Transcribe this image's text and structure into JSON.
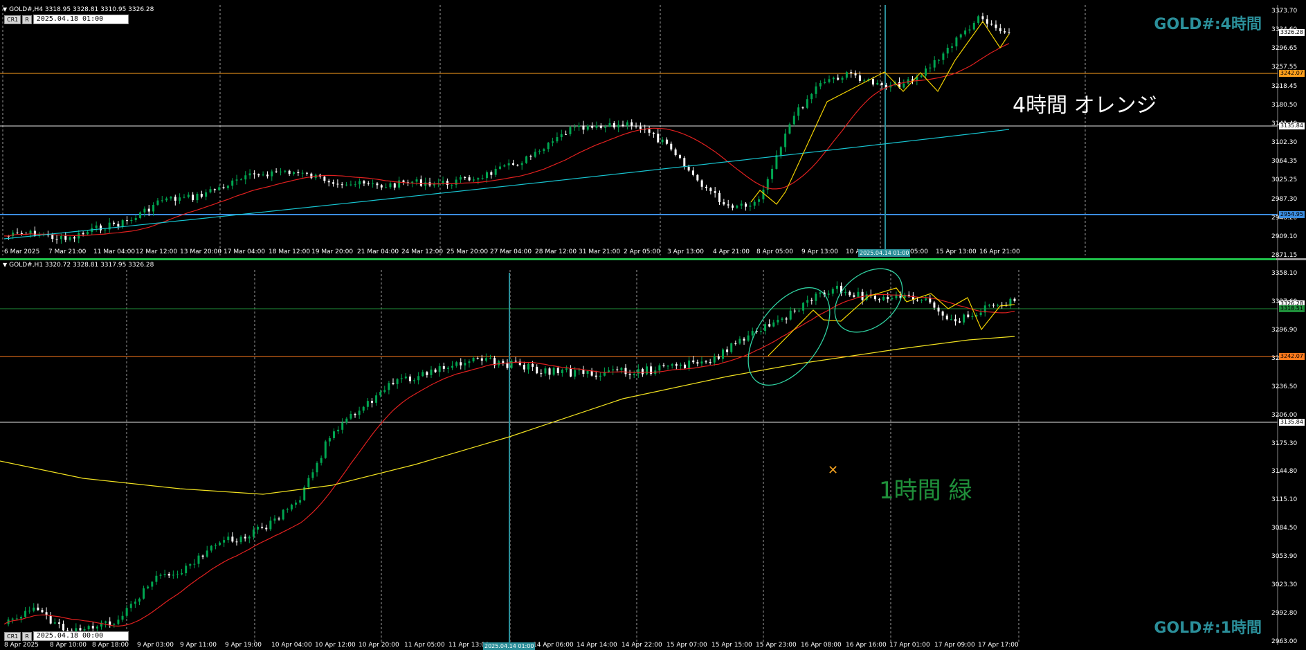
{
  "top": {
    "header": "GOLD#,H4  3318.95 3328.81 3310.95 3326.28",
    "cr_label": "CR1",
    "r_label": "R",
    "date_value": "2025.04.18 01:00",
    "watermark": "GOLD#:4時間",
    "note": "4時間  オレンジ",
    "price_labels": [
      "3373.70",
      "3334.60",
      "3296.65",
      "3257.55",
      "3218.45",
      "3180.50",
      "3141.40",
      "3102.30",
      "3064.35",
      "3025.25",
      "2987.30",
      "2948.20",
      "2909.10",
      "2871.15"
    ],
    "tags": {
      "current": "3326.28",
      "orange": "3242.07",
      "white": "3135.84",
      "blue": "2954.95"
    },
    "time_labels": [
      "6 Mar 2025",
      "7 Mar 21:00",
      "11 Mar 04:00",
      "12 Mar 12:00",
      "13 Mar 20:00",
      "17 Mar 04:00",
      "18 Mar 12:00",
      "19 Mar 20:00",
      "21 Mar 04:00",
      "24 Mar 12:00",
      "25 Mar 20:00",
      "27 Mar 04:00",
      "28 Mar 12:00",
      "31 Mar 21:00",
      "2 Apr 05:00",
      "3 Apr 13:00",
      "4 Apr 21:00",
      "8 Apr 05:00",
      "9 Apr 13:00",
      "10 A",
      "05:00",
      "15 Apr 13:00",
      "16 Apr 21:00"
    ],
    "time_selected": "2025.04.14 01:00",
    "colors": {
      "bull": "#00a651",
      "bear": "#ffffff",
      "ma_fast": "#e0201f",
      "ma_slow": "#17c4d0",
      "zigzag": "#f0d000",
      "orange_line": "#ff9f1c",
      "blue_line": "#3b8de0",
      "cursor": "#2b8f9a"
    }
  },
  "bottom": {
    "header": "GOLD#,H1  3320.72 3328.81 3317.95 3326.28",
    "cr_label": "CR1",
    "r_label": "R",
    "date_value": "2025.04.18 00:00",
    "watermark": "GOLD#:1時間",
    "note": "1時間  緑",
    "price_labels": [
      "3358.10",
      "3327.60",
      "3296.90",
      "3266.20",
      "3236.50",
      "3206.00",
      "3175.30",
      "3144.80",
      "3115.10",
      "3084.50",
      "3053.90",
      "3023.30",
      "2992.80",
      "2963.00"
    ],
    "tags": {
      "current": "3326.28",
      "green": "3318.51",
      "orange": "3242.07",
      "white": "3135.84"
    },
    "time_labels": [
      "8 Apr 2025",
      "8 Apr 10:00",
      "8 Apr 18:00",
      "9 Apr 03:00",
      "9 Apr 11:00",
      "9 Apr 19:00",
      "10 Apr 04:00",
      "10 Apr 12:00",
      "10 Apr 20:00",
      "11 Apr 05:00",
      "11 Apr 13:00",
      "14 Apr 06:00",
      "14 Apr 14:00",
      "14 Apr 22:00",
      "15 Apr 07:00",
      "15 Apr 15:00",
      "15 Apr 23:00",
      "16 Apr 08:00",
      "16 Apr 16:00",
      "17 Apr 01:00",
      "17 Apr 09:00",
      "17 Apr 17:00"
    ],
    "time_selected": "2025.04.14 01:00",
    "colors": {
      "bull": "#00a651",
      "bear": "#ffffff",
      "ma_fast": "#e0201f",
      "ma_slow": "#f0e020",
      "zigzag": "#f0d000",
      "green_line": "#1f8f3a",
      "orange_line": "#ff7a1c",
      "circle": "#2fd0a0",
      "cursor": "#2b8f9a"
    }
  }
}
